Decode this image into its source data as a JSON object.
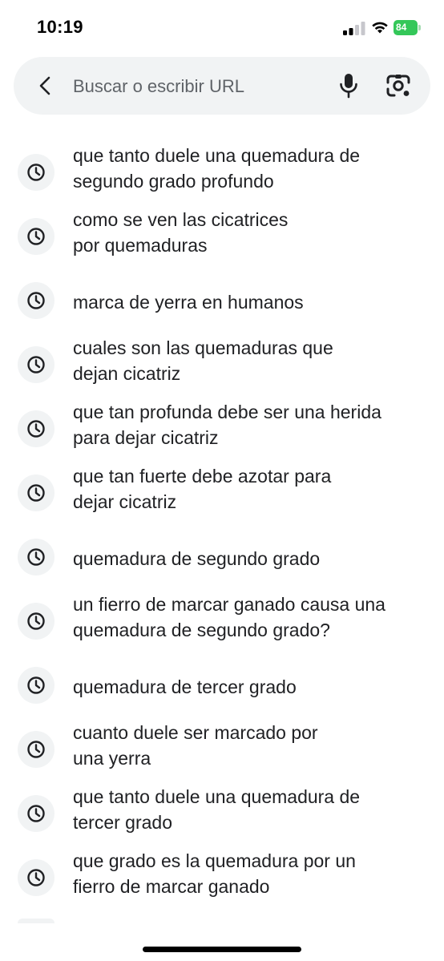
{
  "status": {
    "time": "10:19",
    "battery": "84"
  },
  "search": {
    "placeholder": "Buscar o escribir URL",
    "value": ""
  },
  "suggestions": [
    {
      "line1": "que tanto duele una quemadura de",
      "line2": "segundo grado profundo"
    },
    {
      "line1": "como se ven las cicatrices",
      "line2": "por quemaduras"
    },
    {
      "line1": "marca de yerra en humanos",
      "line2": ""
    },
    {
      "line1": "cuales son las quemaduras que",
      "line2": "dejan cicatriz"
    },
    {
      "line1": "que tan profunda debe ser una herida",
      "line2": "para dejar cicatriz"
    },
    {
      "line1": "que tan fuerte debe azotar para",
      "line2": "dejar cicatriz"
    },
    {
      "line1": "quemadura de segundo grado",
      "line2": ""
    },
    {
      "line1": "un fierro de marcar ganado causa una",
      "line2": "quemadura de segundo grado?"
    },
    {
      "line1": "quemadura de tercer grado",
      "line2": ""
    },
    {
      "line1": "cuanto duele ser marcado por",
      "line2": "una yerra"
    },
    {
      "line1": "que tanto duele una quemadura de",
      "line2": "tercer grado"
    },
    {
      "line1": "que grado es la quemadura por un",
      "line2": "fierro de marcar ganado"
    }
  ],
  "icons": {
    "back": "back-arrow-icon",
    "mic": "microphone-icon",
    "lens": "camera-lens-icon",
    "history": "clock-icon"
  },
  "colors": {
    "battery": "#34c759",
    "search_bg": "#f1f3f4",
    "text": "#202124"
  }
}
